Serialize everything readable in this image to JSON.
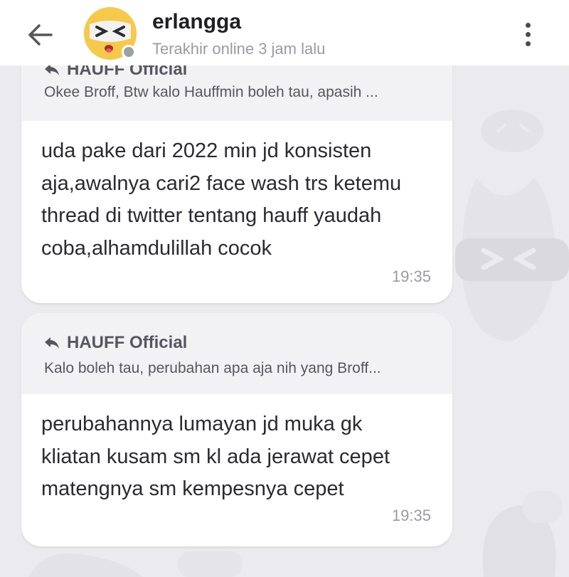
{
  "header": {
    "contact_name": "erlangga",
    "last_seen": "Terakhir online 3 jam lalu",
    "status_color": "#9aa0a6"
  },
  "messages": [
    {
      "quote": {
        "author": "HAUFF Official",
        "text": "Okee Broff, Btw kalo Hauffmin boleh tau, apasih ..."
      },
      "text": "uda pake dari 2022 min jd konsisten aja,awalnya cari2 face wash trs ketemu thread di twitter tentang hauff yaudah coba,alhamdulillah cocok",
      "time": "19:35"
    },
    {
      "quote": {
        "author": "HAUFF Official",
        "text": "Kalo boleh tau, perubahan apa aja nih yang Broff..."
      },
      "text": "perubahannya lumayan jd muka gk kliatan kusam sm kl ada jerawat cepet matengnya sm kempesnya cepet",
      "time": "19:35"
    }
  ],
  "icons": {
    "back": "arrow-left-icon",
    "menu": "more-vertical-icon",
    "reply": "reply-arrow-icon"
  }
}
